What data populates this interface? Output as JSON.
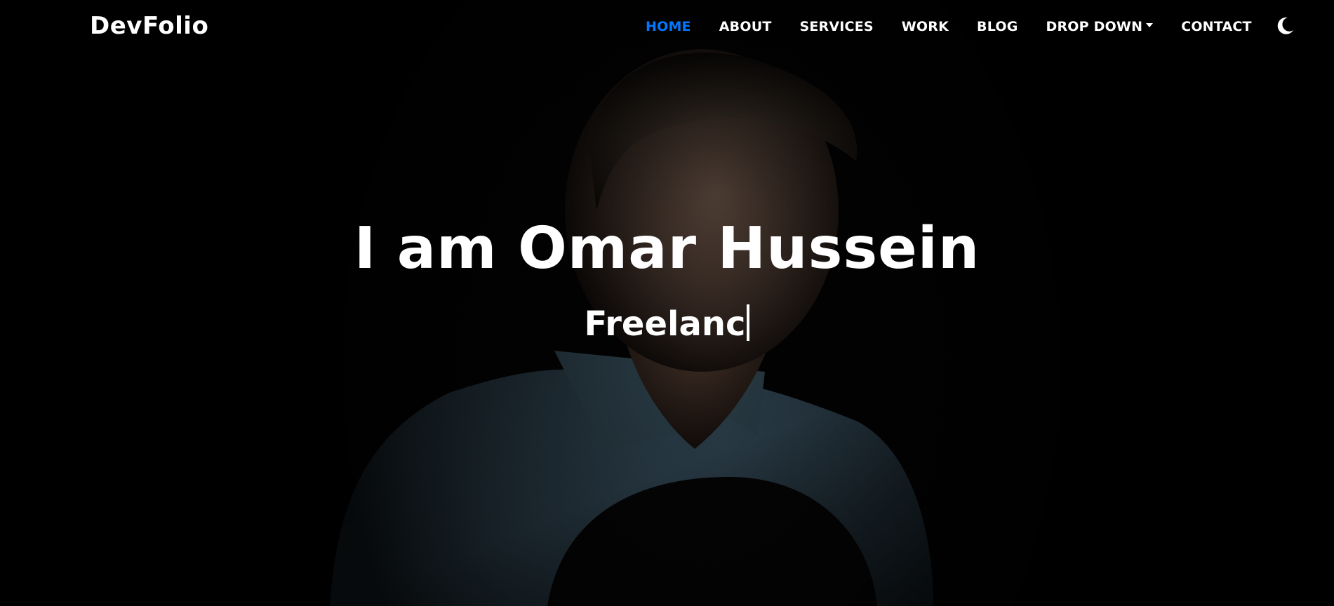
{
  "navbar": {
    "brand": "DevFolio",
    "items": [
      {
        "label": "HOME",
        "active": true
      },
      {
        "label": "ABOUT"
      },
      {
        "label": "SERVICES"
      },
      {
        "label": "WORK"
      },
      {
        "label": "BLOG"
      },
      {
        "label": "DROP DOWN"
      },
      {
        "label": "CONTACT"
      }
    ],
    "theme_toggle_icon": "moon-icon",
    "active_color": "#0078ff"
  },
  "hero": {
    "title": "I am Omar Hussein",
    "typed_text": "Freelanc",
    "background_icon": "portrait-photo"
  }
}
